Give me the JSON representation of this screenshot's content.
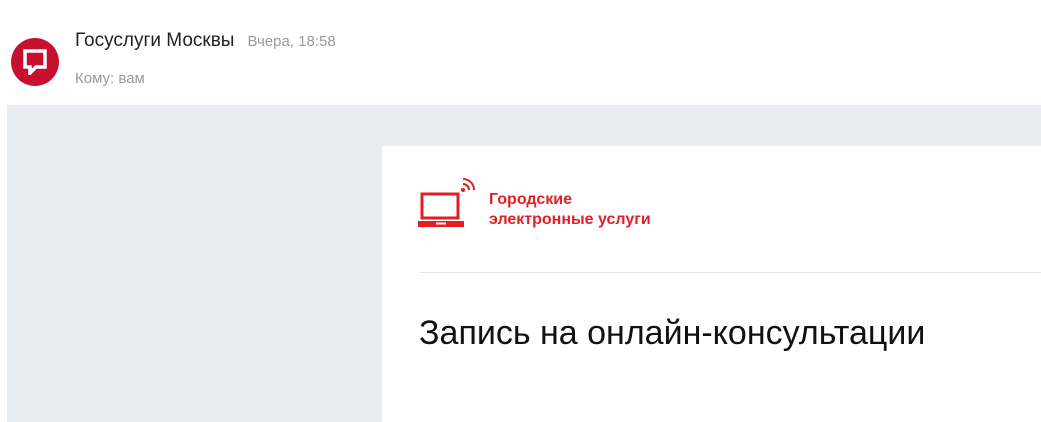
{
  "message": {
    "sender_name": "Госуслуги Москвы",
    "date": "Вчера, 18:58",
    "recipient": "Кому: вам",
    "avatar_icon": "speech-bubble-icon",
    "avatar_color": "#c8102e"
  },
  "email": {
    "brand_line1": "Городские",
    "brand_line2": "электронные услуги",
    "brand_logo_icon": "laptop-wifi-icon",
    "brand_color": "#e31e24",
    "title": "Запись на онлайн-консультации"
  }
}
